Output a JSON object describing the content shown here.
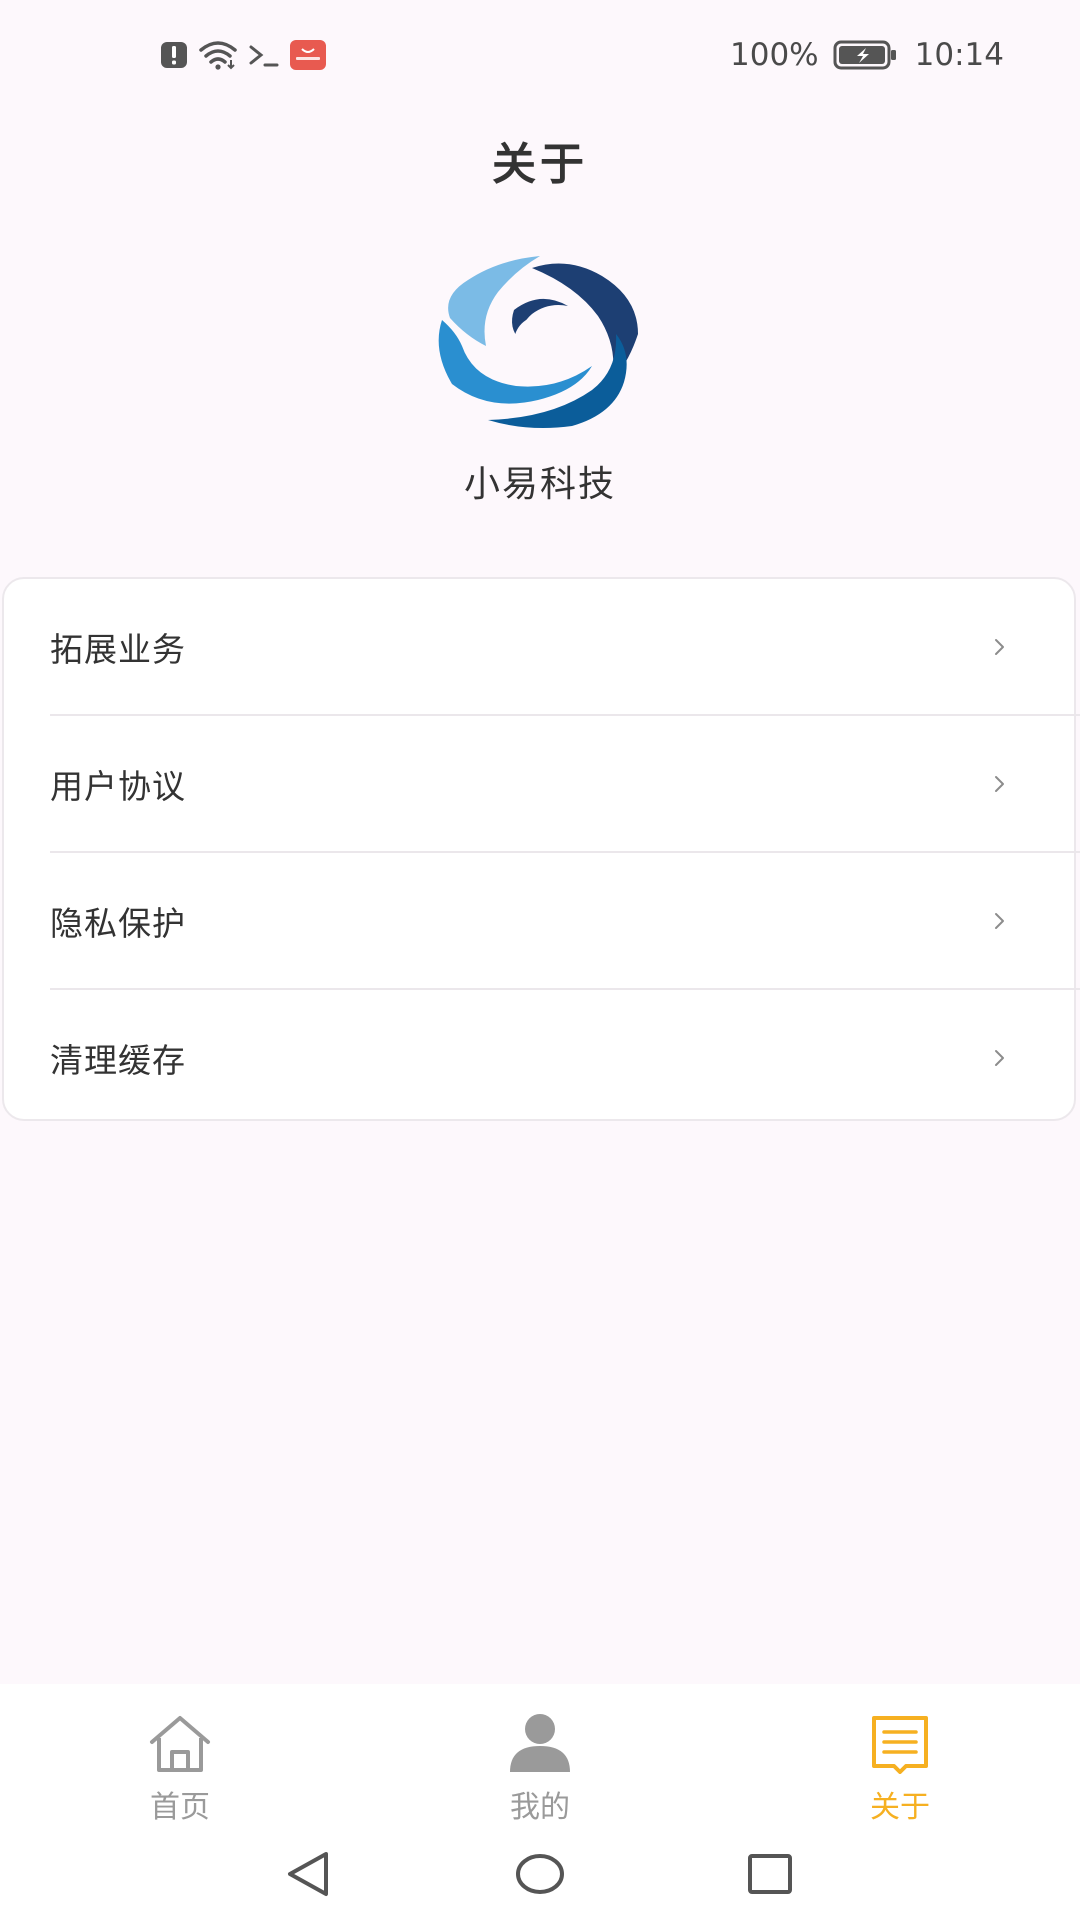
{
  "status_bar": {
    "battery_percent": "100%",
    "time": "10:14",
    "icons": [
      "alert-icon",
      "wifi-icon",
      "terminal-icon",
      "huawei-store-icon"
    ],
    "right_icons": [
      "battery-charging-icon"
    ]
  },
  "header": {
    "title": "关于"
  },
  "brand": {
    "logo": "company-logo",
    "company_name": "小易科技",
    "logo_colors": [
      "#7bbbe6",
      "#2a8fd0",
      "#0b5d9a",
      "#1d3f73"
    ]
  },
  "menu": {
    "items": [
      {
        "label": "拓展业务",
        "icon": "chevron-right-icon"
      },
      {
        "label": "用户协议",
        "icon": "chevron-right-icon"
      },
      {
        "label": "隐私保护",
        "icon": "chevron-right-icon"
      },
      {
        "label": "清理缓存",
        "icon": "chevron-right-icon"
      }
    ]
  },
  "tab_bar": {
    "tabs": [
      {
        "label": "首页",
        "icon": "home-icon",
        "active": false
      },
      {
        "label": "我的",
        "icon": "person-icon",
        "active": false
      },
      {
        "label": "关于",
        "icon": "document-icon",
        "active": true
      }
    ],
    "active_color": "#f6b021",
    "inactive_color": "#9a9a9a"
  },
  "nav_bar": {
    "buttons": [
      "back-icon",
      "home-circle-icon",
      "recents-icon"
    ]
  }
}
